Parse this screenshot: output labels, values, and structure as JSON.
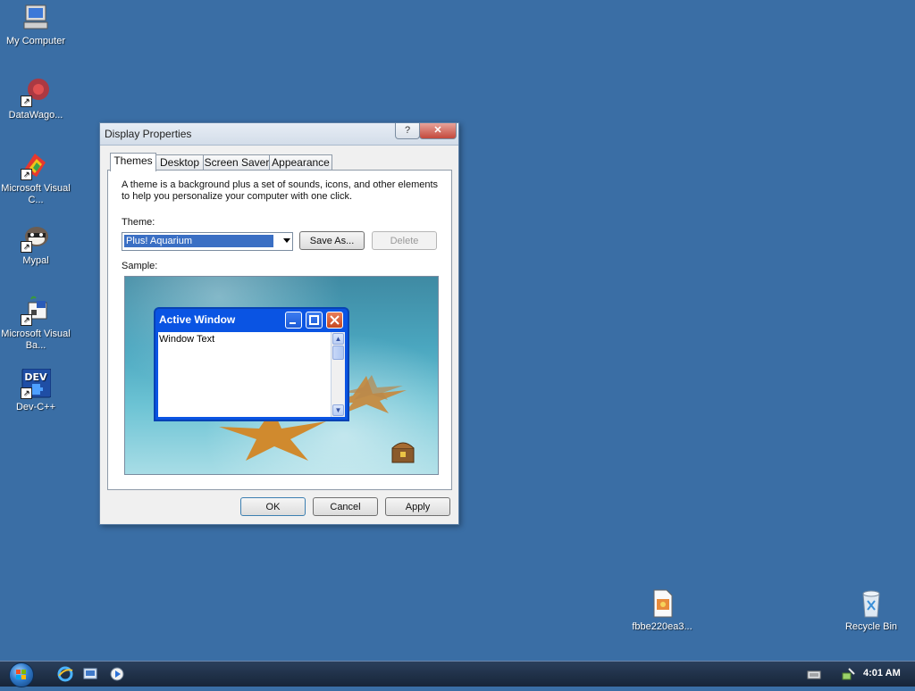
{
  "colors": {
    "desktop_bg": "#3a6ea5",
    "taskbar_bg": "#1d2e45",
    "selection": "#3a6fc4",
    "xp_blue": "#0a54e3"
  },
  "desktop_icons": [
    {
      "label": "My Computer",
      "icon": "computer-icon"
    },
    {
      "label": "DataWago...",
      "icon": "datawagon-icon"
    },
    {
      "label": "Microsoft Visual C...",
      "icon": "visual-c-icon"
    },
    {
      "label": "Mypal",
      "icon": "mypal-icon"
    },
    {
      "label": "Microsoft Visual Ba...",
      "icon": "visual-basic-icon"
    },
    {
      "label": "Dev-C++",
      "icon": "dev-cpp-icon"
    },
    {
      "label": "fbbe220ea3...",
      "icon": "file-icon"
    },
    {
      "label": "Recycle Bin",
      "icon": "recycle-bin-icon"
    }
  ],
  "dialog": {
    "title": "Display Properties",
    "help_glyph": "?",
    "close_glyph": "✕",
    "tabs": [
      {
        "label": "Themes",
        "active": true
      },
      {
        "label": "Desktop"
      },
      {
        "label": "Screen Saver"
      },
      {
        "label": "Appearance"
      }
    ],
    "description": "A theme is a background plus a set of sounds, icons, and other elements to help you personalize your computer with one click.",
    "theme_label": "Theme:",
    "theme_value": "Plus! Aquarium",
    "save_as_label": "Save As...",
    "delete_label": "Delete",
    "sample_label": "Sample:",
    "preview": {
      "window_title": "Active Window",
      "window_text": "Window Text"
    },
    "ok_label": "OK",
    "cancel_label": "Cancel",
    "apply_label": "Apply"
  },
  "taskbar": {
    "start_icon": "windows-start-icon",
    "quick_launch": [
      "internet-explorer-icon",
      "show-desktop-icon",
      "media-player-icon"
    ],
    "tray_icons": [
      "keyboard-icon",
      "network-icon"
    ],
    "time": "4:01 AM"
  }
}
